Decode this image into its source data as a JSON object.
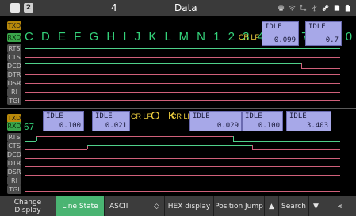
{
  "status": {
    "page_box": "2",
    "page_number": "4",
    "title": "Data",
    "icons": [
      "printer-icon",
      "wifi-icon",
      "network-icon",
      "usb-icon",
      "link-icon",
      "sd-card-icon",
      "battery-icon"
    ]
  },
  "section_top": {
    "labels": [
      "TXD",
      "RXD",
      "RTS",
      "CTS",
      "DCD",
      "DTR",
      "DSR",
      "RI",
      "TGI"
    ],
    "rxd_text": "C D E F G H I J K L M N 1 2 3 4 5 6 7 8 9 0",
    "crlf": "CR LF",
    "idle_boxes": [
      {
        "label": "IDLE",
        "value": "0.099"
      },
      {
        "label": "IDLE",
        "value": "0.7"
      }
    ]
  },
  "section_bottom": {
    "labels": [
      "TXD",
      "RXD",
      "RTS",
      "CTS",
      "DCD",
      "DTR",
      "DSR",
      "RI",
      "TGI"
    ],
    "rxd_prefix": "67",
    "ok_text": "O K",
    "crlf": "CR LF",
    "idle_boxes": [
      {
        "label": "IDLE",
        "value": "0.100"
      },
      {
        "label": "IDLE",
        "value": "0.021"
      },
      {
        "label": "IDLE",
        "value": "0.029"
      },
      {
        "label": "IDLE",
        "value": "0.100"
      },
      {
        "label": "IDLE",
        "value": "3.403"
      }
    ]
  },
  "toolbar": {
    "change_display": "Change Display",
    "line_state": "Line State",
    "encoding": "ASCII",
    "hex_display": "HEX display",
    "position_jump": "Position Jump",
    "search": "Search",
    "up_arrow": "▲",
    "down_arrow": "▼",
    "updown": "◇",
    "menu": "⫷"
  },
  "colors": {
    "rxd_green": "#34d27a",
    "txd_amber": "#b8880a",
    "idle_lavender": "#a7a8e8",
    "line_state_active": "#4ab472",
    "signal_pink": "#d0607a",
    "signal_green": "#4fd08a",
    "crlf_yellow": "#f0d040"
  }
}
